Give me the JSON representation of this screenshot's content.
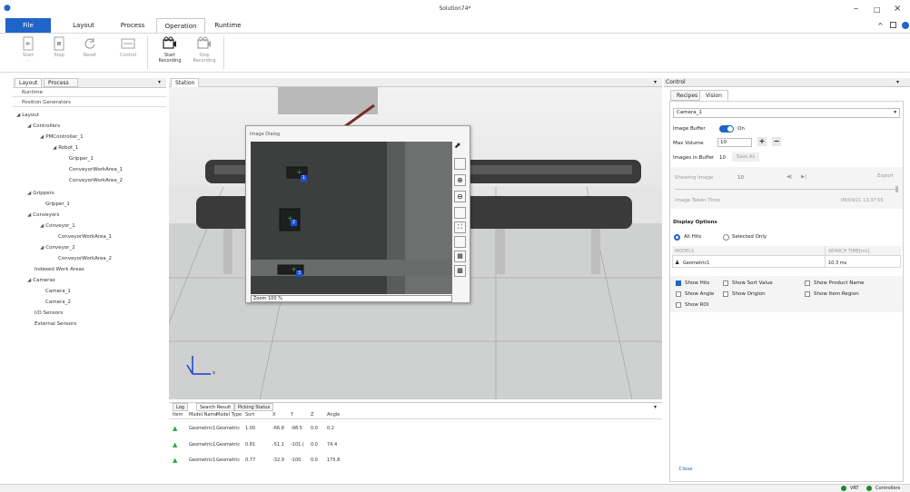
{
  "window": {
    "title": "Solution74*",
    "app_icon": "abb-app-icon"
  },
  "ribbon_tabs": {
    "file": "File",
    "layout": "Layout",
    "process": "Process",
    "operation": "Operation",
    "runtime": "Runtime"
  },
  "ribbon": {
    "start": "Start",
    "stop": "Stop",
    "reset": "Reset",
    "control": "Control",
    "start_recording_1": "Start",
    "start_recording_2": "Recording",
    "stop_recording_1": "Stop",
    "stop_recording_2": "Recording",
    "start_sub": "-"
  },
  "left_panel": {
    "tab_layout": "Layout",
    "tab_process": "Process",
    "items": [
      "Runtime",
      "Position Generators"
    ],
    "tree": {
      "layout": "Layout",
      "controllers": "Controllers",
      "pmcontroller": "PMController_1",
      "robot": "Robot_1",
      "gripper": "Gripper_1",
      "cwa1": "ConveyorWorkArea_1",
      "cwa2": "ConveyorWorkArea_2",
      "grippers": "Grippers",
      "gripper1": "Gripper_1",
      "conveyors": "Conveyors",
      "conveyor1": "Conveyor_1",
      "c1wa": "ConveyorWorkArea_1",
      "conveyor2": "Conveyor_2",
      "c2wa": "ConveyorWorkArea_2",
      "indexed": "Indexed Work Areas",
      "cameras": "Cameras",
      "camera1": "Camera_1",
      "camera2": "Camera_2",
      "io": "I/O Sensors",
      "ext": "External Sensors"
    }
  },
  "station": {
    "tab": "Station",
    "axis_x": "x"
  },
  "image_dialog": {
    "title": "Image Dialog",
    "zoom": "Zoom 100 %",
    "hits": [
      "1",
      "2",
      "3"
    ]
  },
  "bottom": {
    "tabs": {
      "log": "Log",
      "search": "Search Result",
      "picking": "Picking Status"
    },
    "headers": [
      "Item",
      "Model Name",
      "Model Type",
      "Sort",
      "X",
      "Y",
      "Z",
      "Angle"
    ],
    "rows": [
      [
        "Geometric1",
        "Geometric",
        "1.00",
        "-66.8",
        "-98.5",
        "0.0",
        "0.2"
      ],
      [
        "Geometric1",
        "Geometric",
        "0.81",
        "-51.1",
        "-101.(",
        "0.0",
        "74.4"
      ],
      [
        "Geometric1",
        "Geometric",
        "0.77",
        "-32.9",
        "-100.",
        "0.0",
        "175.8"
      ]
    ]
  },
  "control": {
    "header": "Control",
    "tab_recipes": "Recipes",
    "tab_vision": "Vision",
    "camera_select": "Camera_1",
    "image_buffer_label": "Image Buffer",
    "image_buffer_state": "On",
    "max_volume_label": "Max Volume",
    "max_volume_value": "10",
    "plus": "+",
    "minus": "−",
    "images_in_buffer_label": "Images in Buffer",
    "images_in_buffer_value": "10",
    "save_as": "Save As",
    "showing_image_label": "Showing Image",
    "showing_image_value": "10",
    "export": "Export",
    "image_taken_label": "Image Taken Time",
    "image_taken_value": "08/04/21 13:37:55",
    "display_options": "Display Options",
    "all_hits": "All Hits",
    "selected_only": "Selected Only",
    "models_col": "MODELS",
    "search_time_col": "SEARCH TIME[ms]",
    "model_name": "Geometric1",
    "model_time": "10.3 ms",
    "checks": {
      "show_hits": "Show Hits",
      "show_sort_value": "Show Sort Value",
      "show_product_name": "Show Product Name",
      "show_angle": "Show Angle",
      "show_origin": "Show Origion",
      "show_item_region": "Show Item Region",
      "show_roi": "Show ROI"
    },
    "close": "Close"
  },
  "status": {
    "vrt": "VRT",
    "controllers": "Controllers",
    "ok_color": "#1a8a2a"
  },
  "colors": {
    "accent": "#1f64c8",
    "hit_marker": "#2aa84a",
    "hit_badge": "#1f4fd8"
  }
}
